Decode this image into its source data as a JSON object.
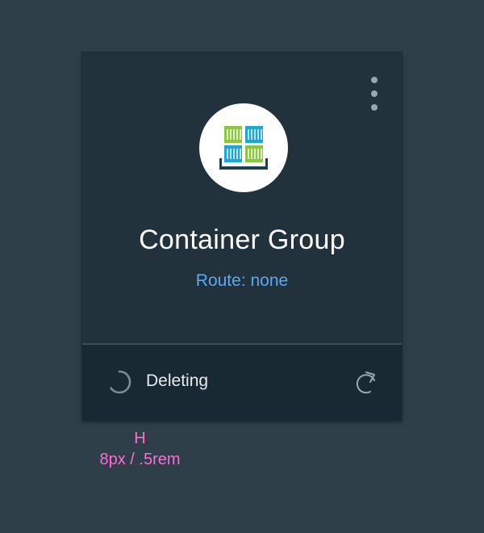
{
  "card": {
    "title": "Container Group",
    "route": "Route: none",
    "status": "Deleting"
  },
  "icons": {
    "menu": "kebab-menu-icon",
    "logo": "container-group-icon",
    "spinner": "loading-spinner-icon",
    "refresh": "refresh-icon"
  },
  "colors": {
    "background": "#2f3f49",
    "card": "#22323d",
    "footer": "#192933",
    "route": "#5aa9f2",
    "annotation": "#ff6ad5",
    "container_green": "#8cc63f",
    "container_blue": "#1ea6d6",
    "pallet": "#1d3f55"
  },
  "annotation": {
    "marker": "H",
    "spacing": "8px / .5rem"
  }
}
